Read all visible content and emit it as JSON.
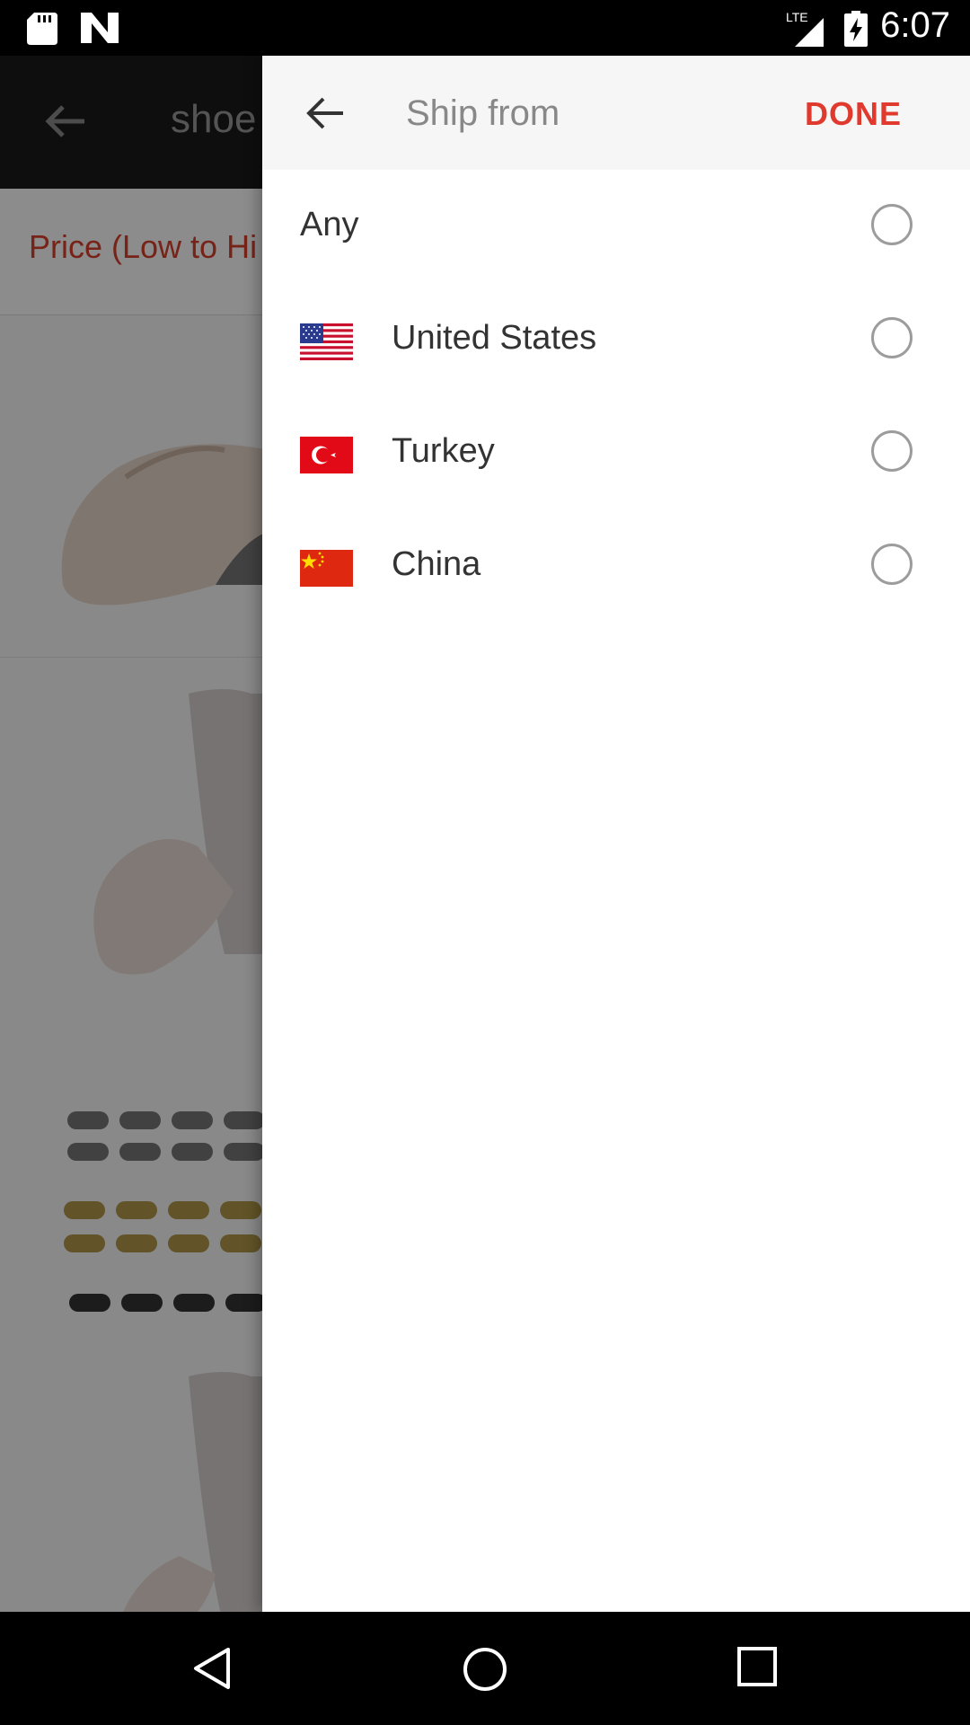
{
  "status_bar": {
    "time": "6:07",
    "network": "LTE"
  },
  "background": {
    "search_query": "shoe",
    "sort_label": "Price (Low to Hi"
  },
  "drawer": {
    "title": "Ship from",
    "done_label": "DONE",
    "options": [
      {
        "label": "Any",
        "flag": null,
        "selected": false
      },
      {
        "label": "United States",
        "flag": "us-flag-icon",
        "selected": false
      },
      {
        "label": "Turkey",
        "flag": "turkey-flag-icon",
        "selected": false
      },
      {
        "label": "China",
        "flag": "china-flag-icon",
        "selected": false
      }
    ]
  },
  "colors": {
    "accent": "#e03a2f",
    "title_gray": "#888888"
  },
  "nav_bar": {
    "icons": [
      "back-triangle-icon",
      "home-circle-icon",
      "recents-square-icon"
    ]
  }
}
